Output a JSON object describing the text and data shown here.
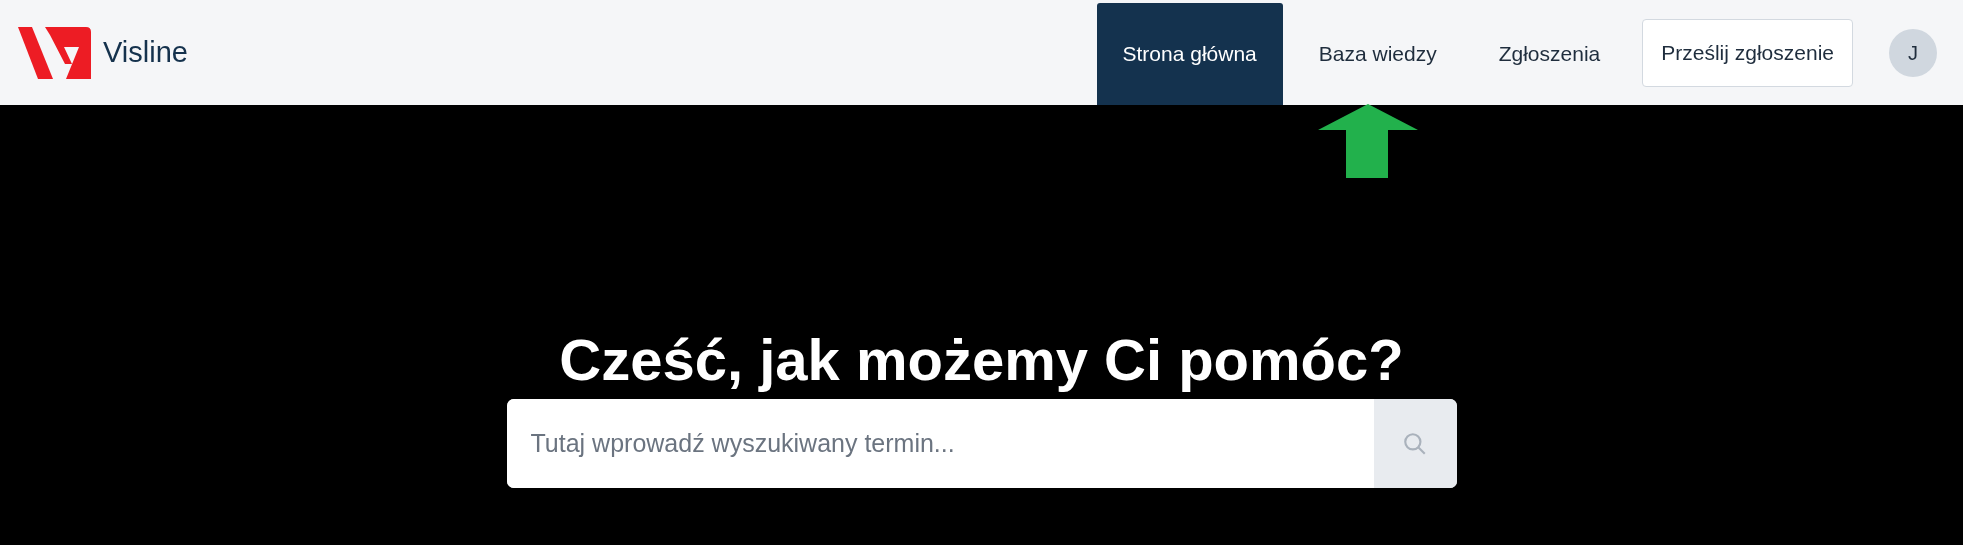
{
  "brand": {
    "name": "Visline"
  },
  "nav": [
    {
      "label": "Strona główna",
      "selected": true
    },
    {
      "label": "Baza wiedzy",
      "selected": false
    },
    {
      "label": "Zgłoszenia",
      "selected": false
    }
  ],
  "submit_button": "Prześlij zgłoszenie",
  "avatar": "J",
  "hero": {
    "heading": "Cześć, jak możemy Ci pomóc?",
    "search": {
      "placeholder": "Tutaj wprowadź wyszukiwany termin..."
    }
  }
}
